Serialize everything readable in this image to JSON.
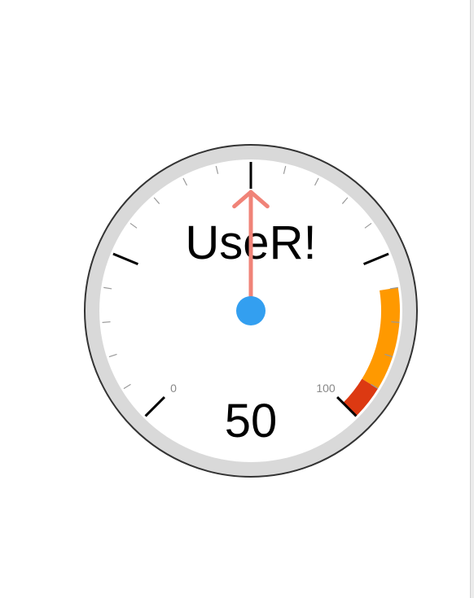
{
  "gauge": {
    "label": "UseR!",
    "value_text": "50",
    "value": 50,
    "min": 0,
    "max": 100,
    "min_label": "0",
    "max_label": "100",
    "bands": [
      {
        "from": 80,
        "to": 95,
        "color": "#ff9900"
      },
      {
        "from": 95,
        "to": 100,
        "color": "#dc3912"
      }
    ],
    "colors": {
      "bezel": "#d9d9d9",
      "rim": "#333333",
      "face": "#ffffff",
      "needle": "#f08378",
      "hub": "#339ff0",
      "major_tick": "#000000",
      "minor_tick": "#999999",
      "tick_label": "#888888",
      "text": "#000000"
    }
  }
}
